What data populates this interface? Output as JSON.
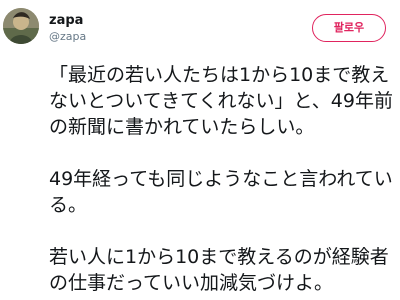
{
  "user": {
    "display_name": "zapa",
    "handle": "@zapa"
  },
  "follow_button": {
    "label": "팔로우"
  },
  "tweet": {
    "lines": [
      "「最近の若い人たちは1から10まで教え",
      "ないとついてきてくれない」と、49年前",
      "の新聞に書かれていたらしい。",
      "49年経っても同じようなこと言われてい",
      "る。",
      "若い人に1から10まで教えるのが経験者",
      "の仕事だっていい加減気づけよ。"
    ]
  },
  "colors": {
    "accent": "#e0245e",
    "text": "#14171a",
    "muted": "#657786"
  },
  "icons": {
    "avatar": "profile-avatar-image"
  }
}
